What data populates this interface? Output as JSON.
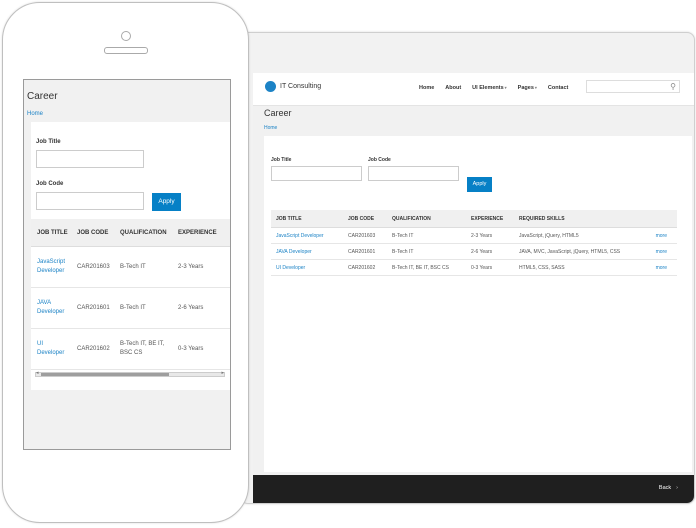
{
  "page_title": "Career",
  "breadcrumb": "Home",
  "brand": {
    "name": "IT Consulting",
    "accent_color": "#1c83c6"
  },
  "nav": {
    "items": [
      {
        "label": "Home"
      },
      {
        "label": "About"
      },
      {
        "label": "UI Elements"
      },
      {
        "label": "Pages"
      },
      {
        "label": "Contact"
      }
    ]
  },
  "search": {
    "placeholder": "",
    "icon": "search-icon"
  },
  "filters": {
    "job_title_label": "Job Title",
    "job_title_value": "",
    "job_code_label": "Job Code",
    "job_code_value": "",
    "apply_label": "Apply"
  },
  "table": {
    "headers": [
      "JOB TITLE",
      "JOB CODE",
      "QUALIFICATION",
      "EXPERIENCE",
      "REQUIRED SKILLS"
    ],
    "rows": [
      {
        "title": "JavaScript Developer",
        "code": "CAR201603",
        "qualification": "B-Tech IT",
        "experience": "2-3 Years",
        "skills": "JavaScript, jQuery, HTML5",
        "more": "more"
      },
      {
        "title": "JAVA Developer",
        "code": "CAR201601",
        "qualification": "B-Tech IT",
        "experience": "2-6 Years",
        "skills": "JAVA, MVC, JavaScript, jQuery, HTML5, CSS",
        "more": "more"
      },
      {
        "title": "UI Developer",
        "code": "CAR201602",
        "qualification": "B-Tech IT, BE IT, BSC CS",
        "experience": "0-3 Years",
        "skills": "HTML5, CSS, SASS",
        "more": "more"
      }
    ]
  },
  "footer": {
    "back_label": "Back"
  }
}
